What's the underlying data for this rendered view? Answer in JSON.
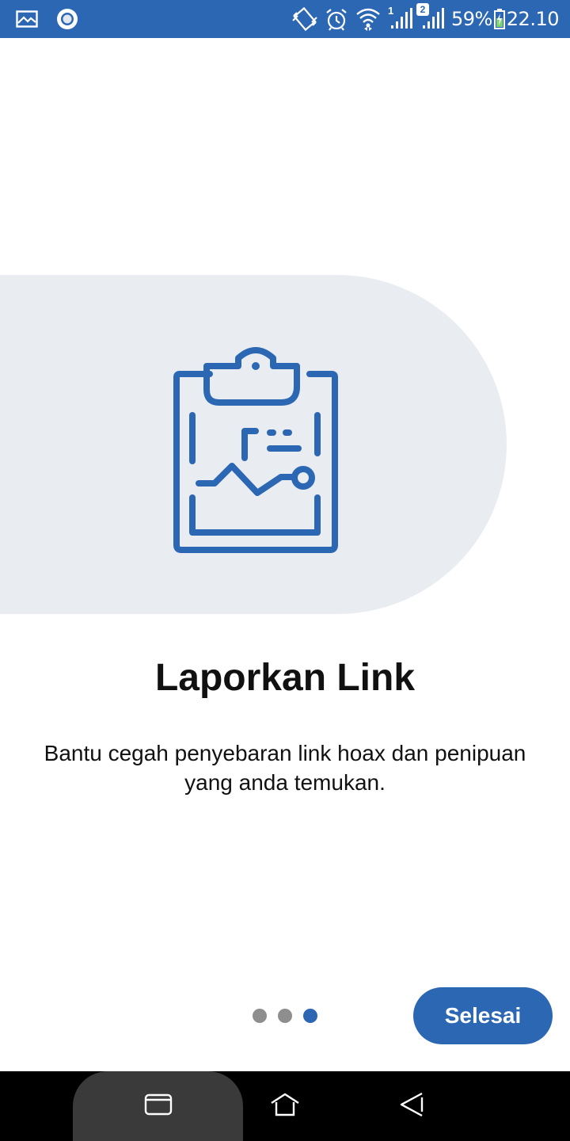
{
  "status_bar": {
    "left_icons": [
      "gallery-icon",
      "circle-record-icon"
    ],
    "right_icons": [
      "vibrate-icon",
      "alarm-icon",
      "wifi-icon",
      "signal-sim1-icon",
      "signal-sim2-icon",
      "battery-charging-icon"
    ],
    "sim1_label": "1",
    "sim2_label": "2",
    "battery": "59%",
    "time": "22.10"
  },
  "hero": {
    "icon": "clipboard-chart-icon"
  },
  "content": {
    "title": "Laporkan Link",
    "description": "Bantu cegah penyebaran link hoax dan penipuan yang anda temukan."
  },
  "pager": {
    "count": 3,
    "active_index": 2
  },
  "actions": {
    "finish_label": "Selesai"
  },
  "nav_bar": {
    "buttons": [
      "recent-apps-icon",
      "home-icon",
      "back-icon"
    ]
  },
  "colors": {
    "primary": "#2c67b4",
    "panel": "#e9edf1",
    "dot_inactive": "#8e8e8e",
    "nav_background": "#000000"
  }
}
